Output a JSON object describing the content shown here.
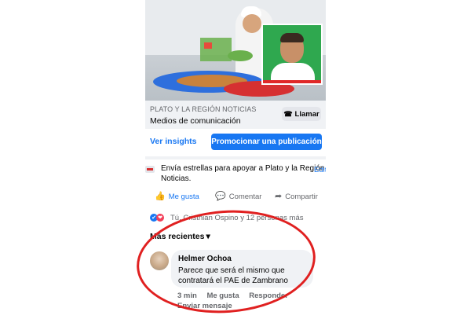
{
  "page": {
    "category": "PLATO Y LA REGIÓN NOTICIAS",
    "type": "Medios de comunicación",
    "call_label": "Llamar"
  },
  "promo": {
    "insights_label": "Ver insights",
    "promote_label": "Promocionar una publicación"
  },
  "stars": {
    "text": "Envía estrellas para apoyar a Plato y la Región Noticias.",
    "edit_label": "Edit"
  },
  "actions": {
    "like_label": "Me gusta",
    "comment_label": "Comentar",
    "share_label": "Compartir"
  },
  "reactions": {
    "summary": "Tú, Cristhian Ospino y 12 personas más"
  },
  "comments": {
    "sort_label": "Más recientes",
    "items": [
      {
        "author": "Helmer Ochoa",
        "text": "Parece que será el mismo que contratará el PAE de Zambrano",
        "time": "3 min",
        "like_label": "Me gusta",
        "reply_label": "Responder",
        "send_label": "Enviar mensaje"
      }
    ]
  },
  "colors": {
    "accent": "#1877f2",
    "annotation_circle": "#e02020"
  },
  "icons": [
    "phone-icon",
    "like-icon",
    "comment-icon",
    "share-icon",
    "chevron-down-icon"
  ]
}
